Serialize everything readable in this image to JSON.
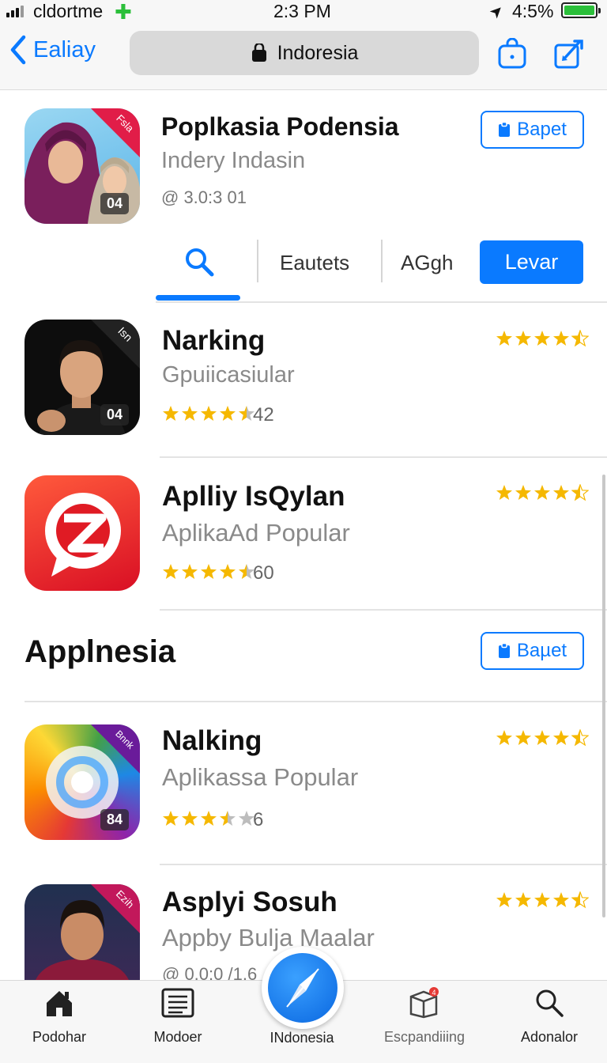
{
  "status_bar": {
    "carrier": "cldortme",
    "time": "2:3 PM",
    "battery_text": "4:5%"
  },
  "nav": {
    "back_label": "Ealiay",
    "search_text": "Indoresia"
  },
  "featured": {
    "title": "Poplkasia Podensia",
    "subtitle": "Indery Indasin",
    "meta": "@ 3.0:3 01",
    "badge": "04",
    "button_label": "Bapet"
  },
  "tabs": {
    "items": [
      "Eautets",
      "AGgh"
    ],
    "active": "Levar"
  },
  "list": [
    {
      "title": "Narking",
      "subtitle": "Gpuiicasiular",
      "rating_count": "42",
      "badge": "04",
      "rating": 4.5,
      "header_rating": 4.5
    },
    {
      "title": "Aplliy IsQylan",
      "subtitle": "AplikaAd Popular",
      "rating_count": "60",
      "rating": 4.5,
      "header_rating": 4.5
    }
  ],
  "section": {
    "heading": "Applnesia",
    "button_label": "Baµet"
  },
  "list2": [
    {
      "title": "Nalking",
      "subtitle": "Aplikassa Popular",
      "rating_count": "6",
      "badge": "84",
      "rating": 3.5,
      "header_rating": 4.5
    },
    {
      "title": "Asplyi Sosuh",
      "subtitle": "Appby Bulja Maalar",
      "meta": "@ 0.0:0 /1.6",
      "header_rating": 4.5
    }
  ],
  "tab_bar": {
    "items": [
      "Podohar",
      "Modoer",
      "INdonesia",
      "Escpandiiing",
      "Adonalor"
    ],
    "notification_count": "4"
  },
  "colors": {
    "accent": "#0a7aff",
    "star": "#f5b800"
  }
}
